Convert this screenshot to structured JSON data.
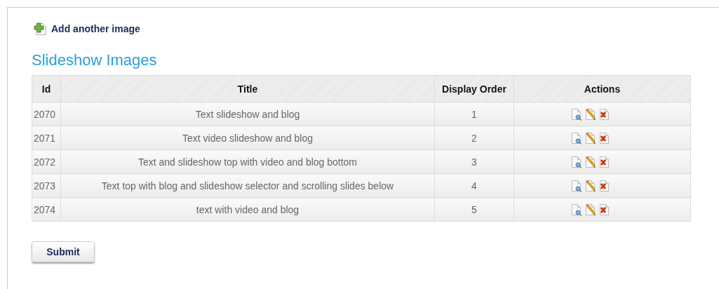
{
  "add_link": "Add another image",
  "heading": "Slideshow Images",
  "table": {
    "columns": [
      "Id",
      "Title",
      "Display Order",
      "Actions"
    ],
    "rows": [
      {
        "id": "2070",
        "title": "Text slideshow and blog",
        "order": "1"
      },
      {
        "id": "2071",
        "title": "Text video slideshow and blog",
        "order": "2"
      },
      {
        "id": "2072",
        "title": "Text and slideshow top with video and blog bottom",
        "order": "3"
      },
      {
        "id": "2073",
        "title": "Text top with blog and slideshow selector and scrolling slides below",
        "order": "4"
      },
      {
        "id": "2074",
        "title": "text with video and blog",
        "order": "5"
      }
    ]
  },
  "submit": "Submit"
}
